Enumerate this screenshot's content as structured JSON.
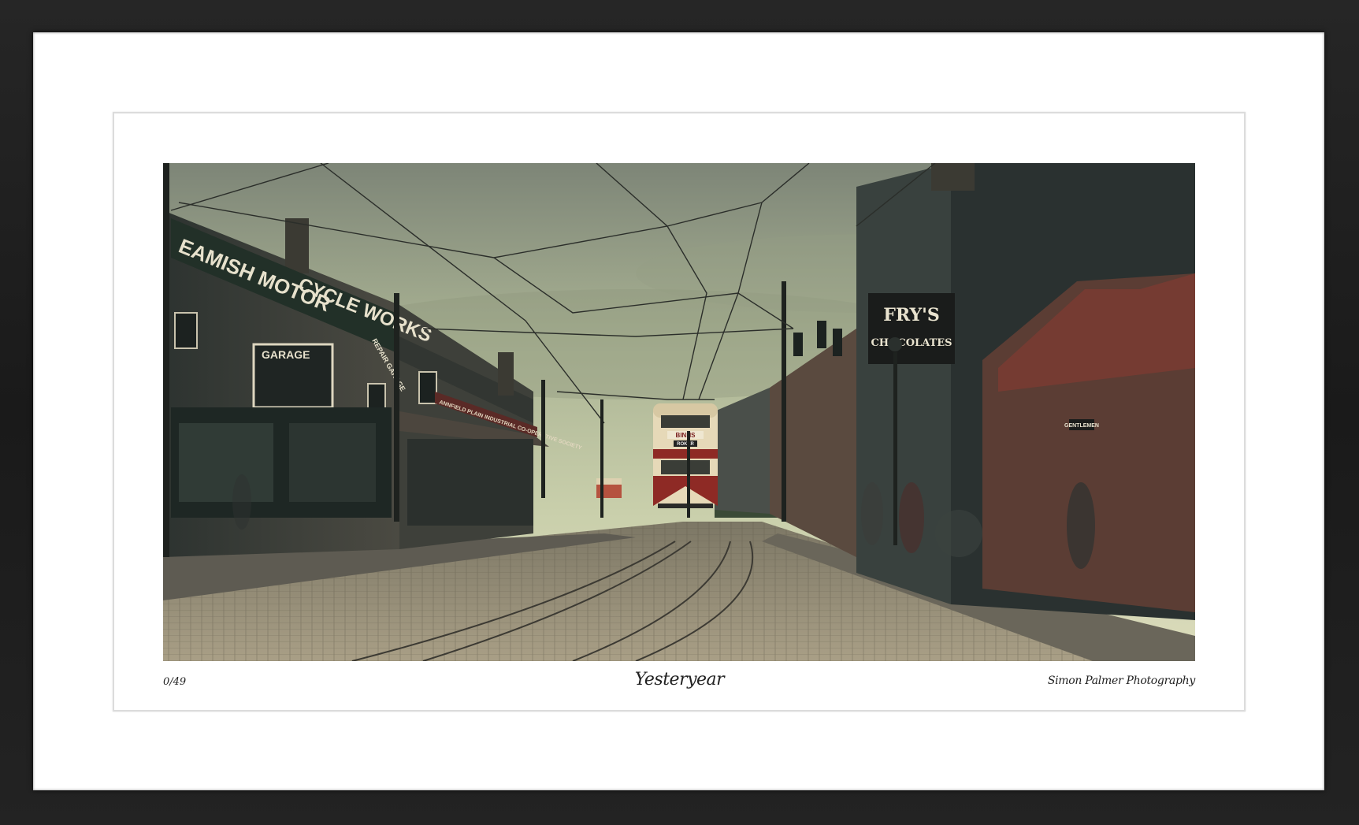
{
  "print": {
    "edition": "0/49",
    "title": "Yesteryear",
    "credit": "Simon Palmer Photography"
  },
  "photo_signs": {
    "motor_works": "EAMISH MOTOR",
    "cycle_works": "CYCLE WORKS",
    "repair_garage": "REPAIR GARAGE",
    "garage": "GARAGE",
    "frys": "FRY'S",
    "chocolates": "CHOCOLATES",
    "tram_destination": "BINNS",
    "tram_route": "ROKER",
    "coop": "ANNFIELD PLAIN INDUSTRIAL CO-OPERATIVE SOCIETY",
    "gentlemen": "GENTLEMEN"
  },
  "colors": {
    "frame": "#1d1d1d",
    "mat": "#ffffff",
    "sky": "#b7bf9c",
    "tram_cream": "#e6d9b8",
    "tram_red": "#8e2a25"
  }
}
